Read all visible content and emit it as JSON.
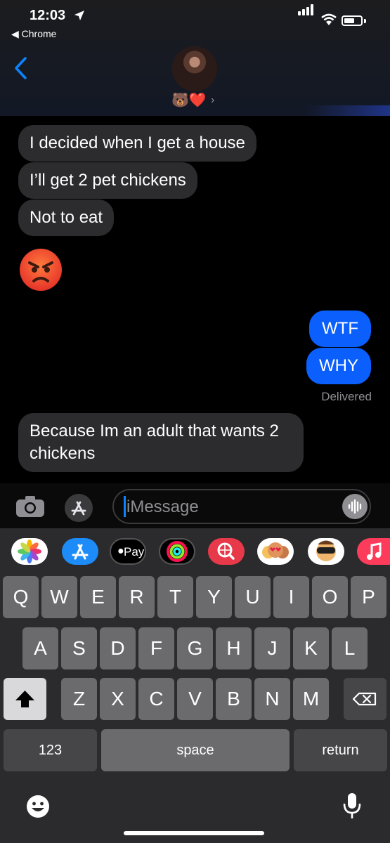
{
  "status_bar": {
    "time": "12:03",
    "back_app": "◀ Chrome"
  },
  "contact": {
    "emojis": "🐻❤️",
    "chevron": "›"
  },
  "messages": [
    {
      "direction": "incoming",
      "text": "I decided when I get a house"
    },
    {
      "direction": "incoming",
      "text": "I’ll get 2 pet chickens"
    },
    {
      "direction": "incoming",
      "text": "Not to eat"
    },
    {
      "direction": "incoming",
      "text": "😡"
    },
    {
      "direction": "outgoing",
      "text": "WTF"
    },
    {
      "direction": "outgoing",
      "text": "WHY"
    },
    {
      "direction": "incoming",
      "text": "Because Im an adult that wants 2 chickens"
    }
  ],
  "delivered_label": "Delivered",
  "input": {
    "placeholder": "iMessage"
  },
  "app_drawer": {
    "items": [
      "photos-icon",
      "app-store-icon",
      "apple-pay-icon",
      "activity-icon",
      "web-search-icon",
      "memoji-icon",
      "memoji-icon",
      "music-icon"
    ],
    "apple_pay_label": "Pay"
  },
  "keyboard": {
    "row1": [
      "Q",
      "W",
      "E",
      "R",
      "T",
      "Y",
      "U",
      "I",
      "O",
      "P"
    ],
    "row2": [
      "A",
      "S",
      "D",
      "F",
      "G",
      "H",
      "J",
      "K",
      "L"
    ],
    "row3": [
      "Z",
      "X",
      "C",
      "V",
      "B",
      "N",
      "M"
    ],
    "numbers_label": "123",
    "space_label": "space",
    "return_label": "return"
  }
}
